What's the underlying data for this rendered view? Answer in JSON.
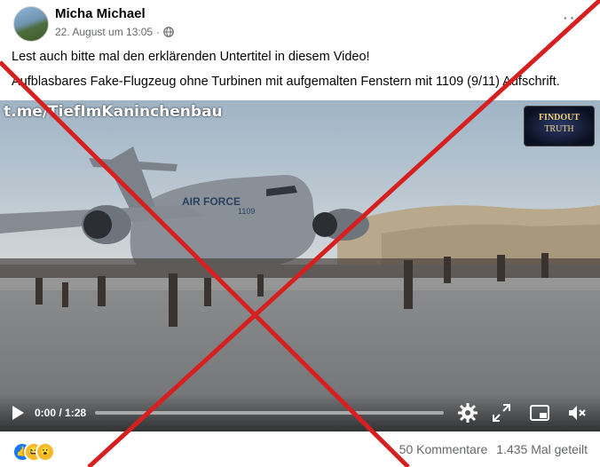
{
  "post": {
    "author": "Micha Michael",
    "date": "22. August um 13:05",
    "dot": "·",
    "more_label": "···",
    "line1": "Lest auch bitte mal den erklärenden Untertitel in diesem Video!",
    "line2": "Aufblasbares Fake-Flugzeug ohne Turbinen mit aufgemalten Fenstern mit 1109 (9/11) Aufschrift."
  },
  "video": {
    "watermark": "t.me/TiefImKaninchenbau",
    "logo_line1": "FINDOUT",
    "logo_line2": "TRUTH",
    "plane_text": "AIR FORCE",
    "plane_number": "1109",
    "time": "0:00 / 1:28",
    "progress": 0.0
  },
  "icons": {
    "globe": "globe-icon",
    "play": "play-icon",
    "settings": "gear-icon",
    "fullscreen": "expand-icon",
    "miniplayer": "miniplayer-icon",
    "volume": "volume-muted-icon"
  },
  "footer": {
    "reactions": [
      "like",
      "haha",
      "wow"
    ],
    "comments": "50 Kommentare",
    "shares": "1.435 Mal geteilt"
  },
  "colors": {
    "cross": "#d62020",
    "like": "#1877f2",
    "secondary_text": "#65676b"
  }
}
